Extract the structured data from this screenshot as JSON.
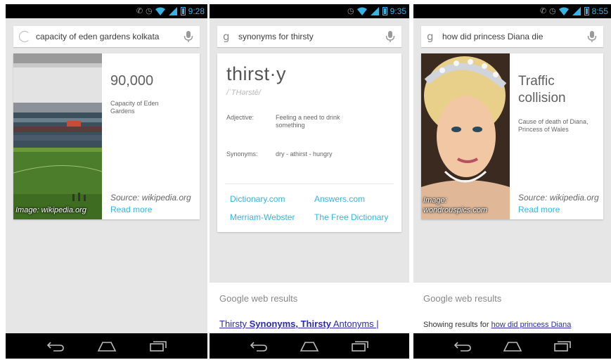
{
  "colors": {
    "accent": "#33b5e5",
    "link": "#2a2ab4",
    "background": "#e6e6e6",
    "card": "#ffffff"
  },
  "phone1": {
    "status_time": "9:28",
    "query": "capacity of eden gardens kolkata",
    "answer": "90,000",
    "answer_description": "Capacity of Eden Gardens",
    "source": "Source: wikipedia.org",
    "read_more": "Read more",
    "image_caption": "Image: wikipedia.org"
  },
  "phone2": {
    "status_time": "9:35",
    "query": "synonyms for thirsty",
    "word": "thirst·y",
    "phonetic": "/ˈTHərstē/",
    "definition_label": "Adjective:",
    "definition": "Feeling a need to drink something",
    "synonyms_label": "Synonyms:",
    "synonyms": "dry - athirst - hungry",
    "dictionary_links": [
      "Dictionary.com",
      "Answers.com",
      "Merriam-Webster",
      "The Free Dictionary"
    ],
    "web_results_header": "Google web results",
    "web_result_parts": [
      "Thirsty ",
      "Synonyms",
      ", ",
      "Thirsty",
      " Antonyms |"
    ]
  },
  "phone3": {
    "status_time": "8:55",
    "query": "how did princess Diana die",
    "answer": "Traffic collision",
    "answer_description": "Cause of death of Diana, Princess of Wales",
    "source": "Source: wikipedia.org",
    "read_more": "Read more",
    "image_caption": "Image: wondrouspics.com",
    "web_results_header": "Google web results",
    "showing_prefix": "Showing results for ",
    "showing_link": "how did princess Diana"
  },
  "icons": [
    "spinner-icon",
    "google-g-icon",
    "microphone-icon",
    "back-icon",
    "home-icon",
    "recent-apps-icon",
    "wifi-icon",
    "signal-icon",
    "battery-icon",
    "alarm-icon"
  ]
}
